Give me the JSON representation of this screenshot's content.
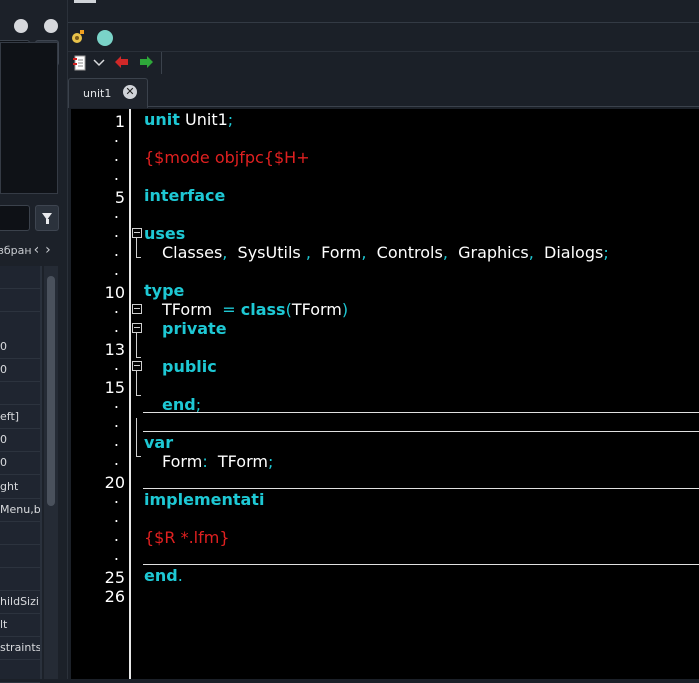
{
  "left_panel": {
    "tab_label": "збран",
    "prev_arrow": "‹",
    "next_arrow": "›",
    "rows": [
      "",
      "",
      "0",
      "0",
      "",
      "eft]",
      "0",
      "0",
      "ght",
      "Menu,b",
      "",
      "",
      "",
      "hildSizi",
      "lt",
      "straints",
      ""
    ]
  },
  "tab": {
    "label": "unit1"
  },
  "gutter": {
    "numbers": [
      {
        "text": "1"
      },
      {
        "text": "5"
      },
      {
        "text": "10"
      },
      {
        "text": "13"
      },
      {
        "text": "15"
      },
      {
        "text": "20"
      },
      {
        "text": "25"
      },
      {
        "text": "26"
      }
    ]
  },
  "code": {
    "l1_kw": "unit",
    "l1_id": "Unit1",
    "l1_sym": ";",
    "l3_dir": "{$mode objfpc{$H+",
    "l5_kw": "interface",
    "l7_kw": "uses",
    "l8_a": "Classes",
    "l8_b": "SysUtils",
    "l8_c": "Form",
    "l8_d": "Controls",
    "l8_e": "Graphics",
    "l8_f": "Dialogs",
    "comma": ",",
    "semi": ";",
    "l10_kw": "type",
    "l11_id": "TForm",
    "l11_eq": "=",
    "l11_kw": "class",
    "l11_paren_open": "(",
    "l11_inner": "TForm",
    "l11_paren_close": ")",
    "l12_kw": "private",
    "l14_kw": "public",
    "l16_kw": "end",
    "l18_kw": "var",
    "l19_id": "Form",
    "l19_colon": ":",
    "l19_type": "TForm",
    "l21_kw": "implementati",
    "l23_dir": "{$R *.lfm}",
    "l25_kw": "end",
    "l25_sym": "."
  },
  "colors": {
    "keyword": "#1ec8d4",
    "directive": "#e02020",
    "identifier": "#ffffff",
    "background": "#000000"
  }
}
